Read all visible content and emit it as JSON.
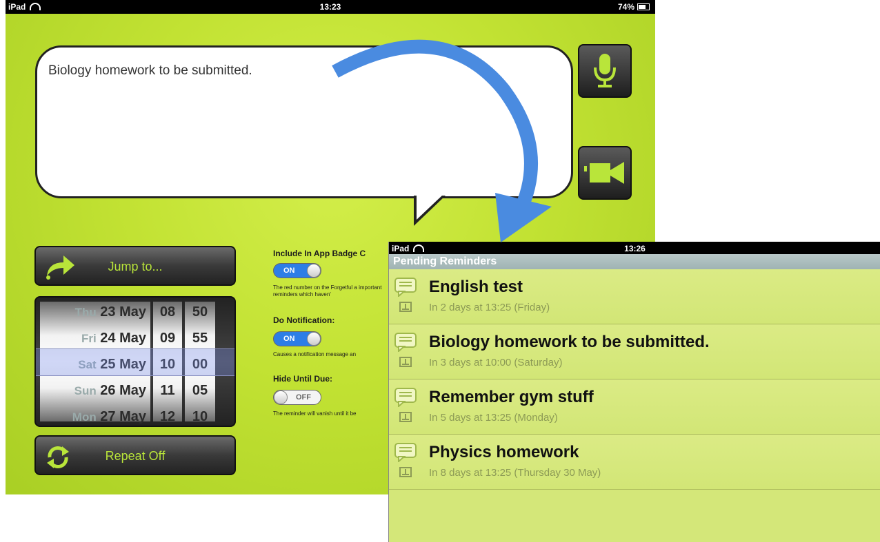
{
  "screen1": {
    "status": {
      "carrier": "iPad",
      "time": "13:23",
      "battery": "74%"
    },
    "reminder_text": "Biology homework to be submitted.",
    "jump_button": "Jump to...",
    "repeat_button": "Repeat Off",
    "picker": {
      "dates": [
        {
          "day": "Thu",
          "date": "23 May"
        },
        {
          "day": "Fri",
          "date": "24 May"
        },
        {
          "day": "Sat",
          "date": "25 May"
        },
        {
          "day": "Sun",
          "date": "26 May"
        },
        {
          "day": "Mon",
          "date": "27 May"
        }
      ],
      "hours": [
        "08",
        "09",
        "10",
        "11",
        "12"
      ],
      "minutes": [
        "50",
        "55",
        "00",
        "05",
        "10"
      ]
    },
    "options": {
      "badge": {
        "label": "Include In App Badge C",
        "state": "ON",
        "note": "The red number on the Forgetful a important reminders which haven'"
      },
      "notification": {
        "label": "Do Notification:",
        "state": "ON",
        "note": "Causes a notification message an"
      },
      "hide": {
        "label": "Hide Until Due:",
        "state": "OFF",
        "note": "The reminder will vanish until it be"
      }
    },
    "icons": {
      "mic": "microphone-icon",
      "video": "video-camera-icon",
      "jump": "forward-arrow-icon",
      "repeat": "repeat-icon"
    },
    "colors": {
      "background": "#c2e233",
      "accent": "#b9e53a",
      "toggle_on": "#2d7ee6"
    }
  },
  "screen2": {
    "status": {
      "carrier": "iPad",
      "time": "13:26"
    },
    "nav_title": "Pending Reminders",
    "reminders": [
      {
        "title": "English test",
        "subtitle": "In 2 days at 13:25 (Friday)"
      },
      {
        "title": "Biology homework to be submitted.",
        "subtitle": "In 3 days at 10:00 (Saturday)"
      },
      {
        "title": "Remember gym stuff",
        "subtitle": "In 5 days at 13:25 (Monday)"
      },
      {
        "title": "Physics homework",
        "subtitle": "In 8 days at 13:25 (Thursday 30 May)"
      }
    ],
    "colors": {
      "row_background": "#d4e779",
      "subtitle": "#8c9a55",
      "nav": "#b8c8c9"
    }
  },
  "overlay": {
    "arrow_color": "#4a8be0"
  }
}
